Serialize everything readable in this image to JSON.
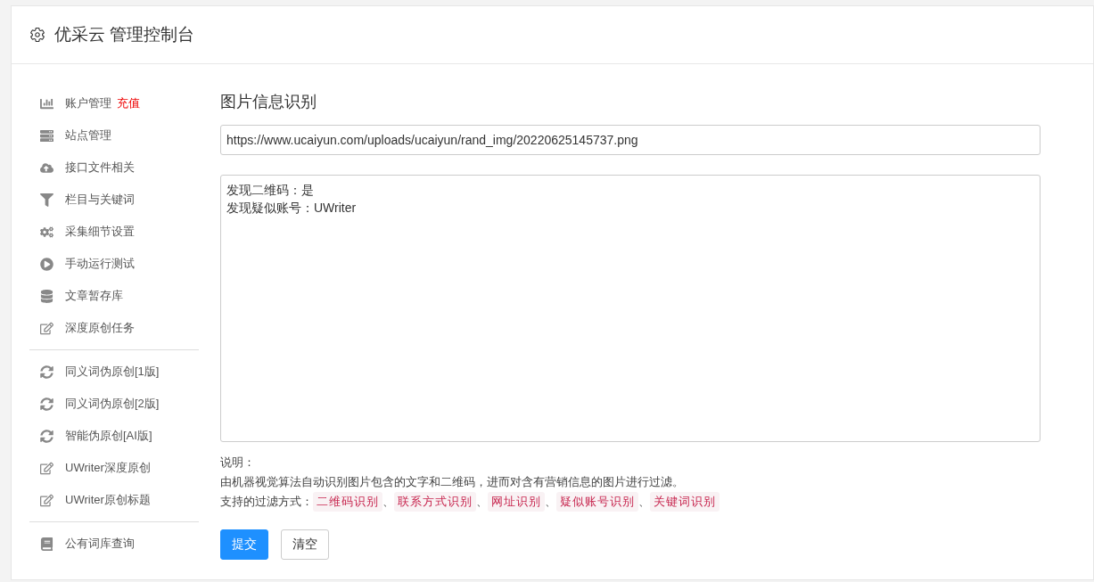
{
  "header": {
    "title": "优采云 管理控制台"
  },
  "sidebar": {
    "groups": [
      [
        {
          "label": "账户管理",
          "badge": "充值"
        },
        {
          "label": "站点管理"
        },
        {
          "label": "接口文件相关"
        },
        {
          "label": "栏目与关键词"
        },
        {
          "label": "采集细节设置"
        },
        {
          "label": "手动运行测试"
        },
        {
          "label": "文章暂存库"
        },
        {
          "label": "深度原创任务"
        }
      ],
      [
        {
          "label": "同义词伪原创[1版]"
        },
        {
          "label": "同义词伪原创[2版]"
        },
        {
          "label": "智能伪原创[AI版]"
        },
        {
          "label": "UWriter深度原创"
        },
        {
          "label": "UWriter原创标题"
        }
      ],
      [
        {
          "label": "公有词库查询"
        }
      ]
    ]
  },
  "main": {
    "title": "图片信息识别",
    "url_field": {
      "value": "https://www.ucaiyun.com/uploads/ucaiyun/rand_img/20220625145737.png"
    },
    "result_box": {
      "lines": [
        "发现二维码：是",
        "发现疑似账号：UWriter"
      ]
    },
    "notes": {
      "heading": "说明：",
      "text": "由机器视觉算法自动识别图片包含的文字和二维码，进而对含有营销信息的图片进行过滤。",
      "methods_label": "支持的过滤方式：",
      "separator": "、",
      "methods": [
        "二维码识别",
        "联系方式识别",
        "网址识别",
        "疑似账号识别",
        "关键词识别"
      ]
    },
    "buttons": [
      {
        "label": "提交",
        "kind": "primary"
      },
      {
        "label": "清空",
        "kind": "default"
      }
    ]
  }
}
